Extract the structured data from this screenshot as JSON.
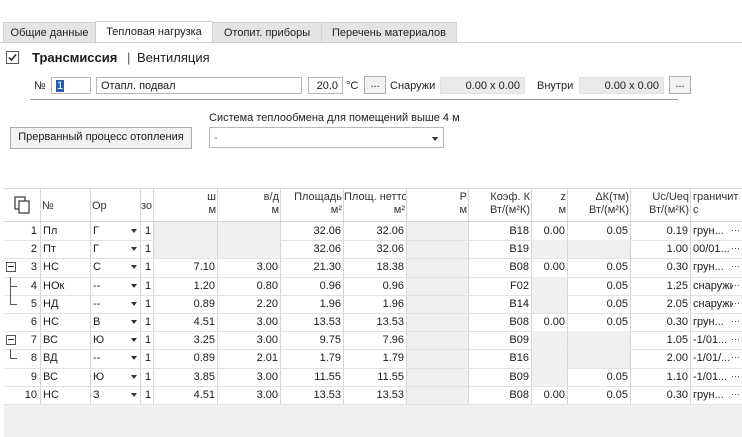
{
  "tabs": [
    {
      "label": "Общие данные",
      "active": false
    },
    {
      "label": "Тепловая нагрузка",
      "active": true
    },
    {
      "label": "Отопит. приборы",
      "active": false
    },
    {
      "label": "Перечень материалов",
      "active": false
    }
  ],
  "header": {
    "transmission_label": "Трансмиссия",
    "separator": "|",
    "ventilation_label": "Вентиляция",
    "transmission_checked": true
  },
  "room": {
    "number_label": "№",
    "number_value": "1",
    "name_value": "Отапл. подвал",
    "temp_value": "20.0",
    "temp_unit": "°C",
    "outside_label": "Снаружи",
    "outside_value": "0.00 x 0.00",
    "inside_label": "Внутри",
    "inside_value": "0.00 x 0.00",
    "ellipsis": "..."
  },
  "interrupted_button": "Прерванный процесс отопления",
  "heat_exchange": {
    "label": "Система теплообмена для помещений выше 4 м",
    "value": "-"
  },
  "table": {
    "headers": {
      "no": "№",
      "or": "Ор",
      "zo": "зо",
      "w": [
        "ш",
        "м"
      ],
      "hd": [
        "в/д",
        "м"
      ],
      "area": [
        "Площадь",
        "м²"
      ],
      "net": [
        "Площ. нетто",
        "м²"
      ],
      "p": [
        "Р",
        "м"
      ],
      "k": [
        "Коэф. К",
        "Вт/(м²К)"
      ],
      "z": [
        "z",
        "м"
      ],
      "dk": [
        "ΔК(тм)",
        "Вт/(м²К)"
      ],
      "uc": [
        "Uc/Ueq",
        "Вт/(м²К)"
      ],
      "border": [
        "граничит",
        "с"
      ]
    },
    "rows": [
      {
        "n": "1",
        "type": "Пл",
        "or": "Г",
        "cnt": "1",
        "w": "",
        "hd": "",
        "area": "32.06",
        "net": "32.06",
        "k": "B18",
        "z": "0.00",
        "dk": "0.05",
        "uc": "0.19",
        "border": "грун...",
        "tree": "",
        "shaded": false
      },
      {
        "n": "2",
        "type": "Пт",
        "or": "Г",
        "cnt": "1",
        "w": "",
        "hd": "",
        "area": "32.06",
        "net": "32.06",
        "k": "B19",
        "z": "",
        "dk": "",
        "uc": "1.00",
        "border": "00/01...",
        "tree": "",
        "shaded": false
      },
      {
        "n": "3",
        "type": "НС",
        "or": "С",
        "cnt": "1",
        "w": "7.10",
        "hd": "3.00",
        "area": "21.30",
        "net": "18.38",
        "k": "B08",
        "z": "0.00",
        "dk": "0.05",
        "uc": "0.30",
        "border": "грун...",
        "tree": "minus",
        "shaded": false
      },
      {
        "n": "4",
        "type": "НОк",
        "or": "--",
        "cnt": "1",
        "w": "1.20",
        "hd": "0.80",
        "area": "0.96",
        "net": "0.96",
        "k": "F02",
        "z": "",
        "dk": "0.05",
        "uc": "1.25",
        "border": "снаружи",
        "tree": "mid",
        "shaded": false
      },
      {
        "n": "5",
        "type": "НД",
        "or": "--",
        "cnt": "1",
        "w": "0.89",
        "hd": "2.20",
        "area": "1.96",
        "net": "1.96",
        "k": "B14",
        "z": "",
        "dk": "0.05",
        "uc": "2.05",
        "border": "снаружи",
        "tree": "end",
        "shaded": false
      },
      {
        "n": "6",
        "type": "НС",
        "or": "В",
        "cnt": "1",
        "w": "4.51",
        "hd": "3.00",
        "area": "13.53",
        "net": "13.53",
        "k": "B08",
        "z": "0.00",
        "dk": "0.05",
        "uc": "0.30",
        "border": "грун...",
        "tree": "",
        "shaded": false
      },
      {
        "n": "7",
        "type": "ВС",
        "or": "Ю",
        "cnt": "1",
        "w": "3.25",
        "hd": "3.00",
        "area": "9.75",
        "net": "7.96",
        "k": "B09",
        "z": "",
        "dk": "",
        "uc": "1.05",
        "border": "-1/01...",
        "tree": "minus",
        "shaded": false
      },
      {
        "n": "8",
        "type": "ВД",
        "or": "--",
        "cnt": "1",
        "w": "0.89",
        "hd": "2.01",
        "area": "1.79",
        "net": "1.79",
        "k": "B16",
        "z": "",
        "dk": "",
        "uc": "2.00",
        "border": "-1/01/...",
        "tree": "end",
        "shaded": false
      },
      {
        "n": "9",
        "type": "ВС",
        "or": "Ю",
        "cnt": "1",
        "w": "3.85",
        "hd": "3.00",
        "area": "11.55",
        "net": "11.55",
        "k": "B09",
        "z": "",
        "dk": "0.05",
        "uc": "1.10",
        "border": "-1/01...",
        "tree": "",
        "shaded": false
      },
      {
        "n": "10",
        "type": "НС",
        "or": "З",
        "cnt": "1",
        "w": "4.51",
        "hd": "3.00",
        "area": "13.53",
        "net": "13.53",
        "k": "B08",
        "z": "0.00",
        "dk": "0.05",
        "uc": "0.30",
        "border": "грун...",
        "tree": "",
        "shaded": false
      }
    ]
  }
}
